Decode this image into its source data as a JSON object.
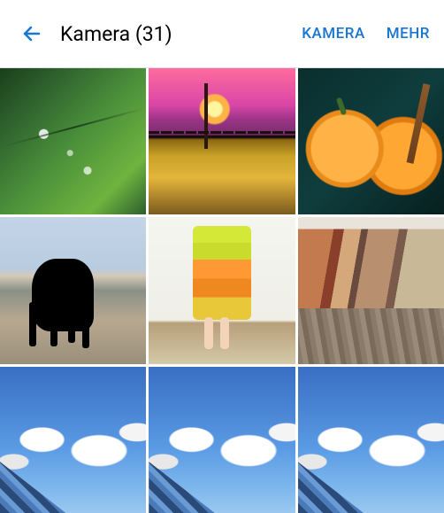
{
  "header": {
    "title": "Kamera (31)",
    "actions": {
      "camera": "KAMERA",
      "more": "MEHR"
    }
  },
  "thumbnails": [
    {
      "name": "photo-leaf-droplets"
    },
    {
      "name": "photo-sunset-flowers"
    },
    {
      "name": "photo-oranges"
    },
    {
      "name": "photo-black-panther"
    },
    {
      "name": "photo-pillows"
    },
    {
      "name": "photo-street"
    },
    {
      "name": "photo-sky-building-1"
    },
    {
      "name": "photo-sky-building-2"
    },
    {
      "name": "photo-sky-building-3"
    }
  ]
}
